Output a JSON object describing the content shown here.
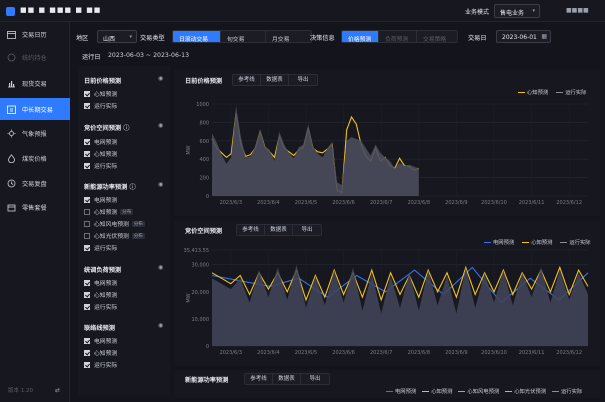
{
  "header": {
    "app_name": "■■ ■ ■■■ ■ ■■",
    "mode_label": "业务模式",
    "mode_value": "售电业务",
    "user": "■■■■"
  },
  "sidebar": {
    "items": [
      {
        "label": "交易日历",
        "icon": "calendar-icon"
      },
      {
        "label": "统约持仓",
        "icon": "position-icon",
        "disabled": true
      },
      {
        "label": "现货交易",
        "icon": "bar-chart-icon"
      },
      {
        "label": "中长期交易",
        "icon": "schedule-icon",
        "active": true
      },
      {
        "label": "气象预报",
        "icon": "sun-icon"
      },
      {
        "label": "煤炭价格",
        "icon": "flame-icon"
      },
      {
        "label": "交易复盘",
        "icon": "history-icon"
      },
      {
        "label": "零售套餐",
        "icon": "package-icon"
      }
    ],
    "version": "版本 1.20"
  },
  "filter": {
    "region_label": "地区",
    "region_value": "山西",
    "trade_type_label": "交易类型",
    "trade_types": [
      "日滚动交易",
      "旬交易",
      "月交易"
    ],
    "decision_label": "决策信息",
    "decisions": [
      "价格预测",
      "负荷预测",
      "交易策略"
    ],
    "trade_date_label": "交易日",
    "trade_date_value": "2023-06-01",
    "run_label": "运行日",
    "run_range": "2023-06-03 ~ 2023-06-13"
  },
  "left_panel": {
    "groups": [
      {
        "title": "日前价格预测",
        "items": [
          {
            "label": "心知预测",
            "checked": true
          },
          {
            "label": "运行实际",
            "checked": true
          }
        ]
      },
      {
        "title": "竞价空间预测",
        "info": true,
        "items": [
          {
            "label": "电网预测",
            "checked": true
          },
          {
            "label": "心知预测",
            "checked": true
          },
          {
            "label": "运行实际",
            "checked": true
          }
        ]
      },
      {
        "title": "新能源功率预测",
        "info": true,
        "items": [
          {
            "label": "电网预测",
            "checked": true
          },
          {
            "label": "心知预测",
            "checked": false,
            "tag": "分布"
          },
          {
            "label": "心知风电预测",
            "checked": false,
            "tag": "分布"
          },
          {
            "label": "心知光伏预测",
            "checked": false,
            "tag": "分布"
          },
          {
            "label": "运行实际",
            "checked": true
          }
        ]
      },
      {
        "title": "统调负荷预测",
        "items": [
          {
            "label": "电网预测",
            "checked": true
          },
          {
            "label": "心知预测",
            "checked": true
          },
          {
            "label": "运行实际",
            "checked": true
          }
        ]
      },
      {
        "title": "联络线预测",
        "items": [
          {
            "label": "电网预测",
            "checked": true
          },
          {
            "label": "心知预测",
            "checked": true
          },
          {
            "label": "运行实际",
            "checked": true
          }
        ]
      }
    ]
  },
  "chart_tabs": [
    "参考线",
    "数据表",
    "导出"
  ],
  "charts": {
    "price": {
      "title": "日前价格预测",
      "legend": [
        "心知预测",
        "运行实际"
      ]
    },
    "bid": {
      "title": "竞价空间预测",
      "legend": [
        "电网预测",
        "心知预测",
        "运行实际"
      ]
    },
    "renew": {
      "title": "新能源功率预测",
      "legend": [
        "电网预测",
        "心知预测",
        "心知风电预测",
        "心知光伏预测",
        "运行实际"
      ]
    }
  },
  "colors": {
    "accent": "#2f7bff",
    "forecast": "#f2c21b",
    "grid_forecast": "#3a6ff0",
    "actual_fill": "#5b5d6e"
  },
  "chart_data": [
    {
      "type": "area",
      "title": "日前价格预测",
      "ylabel": "MW",
      "ylim": [
        0,
        1000
      ],
      "yticks": [
        "0",
        "200",
        "400",
        "600",
        "800",
        "1000"
      ],
      "x": [
        "2023/6/3",
        "2023/6/4",
        "2023/6/5",
        "2023/6/6",
        "2023/6/7",
        "2023/6/8",
        "2023/6/9",
        "2023/6/10",
        "2023/6/11",
        "2023/6/12"
      ],
      "series": [
        {
          "name": "心知预测",
          "values": [
            620,
            520,
            470,
            420,
            460,
            900,
            560,
            430,
            450,
            520,
            700,
            530,
            480,
            420,
            650,
            520,
            480,
            440,
            500,
            530,
            740,
            520,
            480,
            470,
            510,
            560,
            60,
            40,
            720,
            860,
            780,
            560,
            430,
            380,
            520,
            380,
            420,
            330,
            300,
            410,
            330,
            320,
            280,
            300
          ]
        },
        {
          "name": "运行实际",
          "values": [
            680,
            580,
            450,
            350,
            420,
            980,
            640,
            420,
            430,
            540,
            720,
            540,
            500,
            380,
            700,
            560,
            470,
            410,
            530,
            560,
            780,
            540,
            460,
            420,
            520,
            590,
            150,
            120,
            600,
            640,
            620,
            600,
            520,
            440,
            560,
            470,
            420,
            380,
            300,
            360,
            330,
            340,
            320,
            300
          ]
        }
      ]
    },
    {
      "type": "line",
      "title": "竞价空间预测",
      "ylabel": "MW",
      "ylim": [
        0,
        35413.5
      ],
      "yticks": [
        "0",
        "10,000",
        "20,000",
        "30,000",
        "35,413.55"
      ],
      "x": [
        "2023/6/3",
        "2023/6/4",
        "2023/6/5",
        "2023/6/6",
        "2023/6/7",
        "2023/6/8",
        "2023/6/9",
        "2023/6/10",
        "2023/6/11",
        "2023/6/12"
      ],
      "series": [
        {
          "name": "电网预测",
          "values": [
            26000,
            24000,
            22000,
            25000,
            18000,
            26000,
            20000,
            28000,
            19000,
            29000,
            16000,
            25000,
            17000,
            27000
          ]
        },
        {
          "name": "心知预测",
          "values": [
            27000,
            25000,
            23000,
            26000,
            19000,
            27000,
            21000,
            27000,
            20000,
            28000,
            17000,
            26000,
            18000,
            28000,
            19000,
            27000,
            18000,
            28000,
            17000,
            27000,
            19000,
            26000,
            18000,
            28000,
            20000,
            27000,
            18000,
            29000,
            19000,
            27000,
            20000,
            28000,
            19000,
            27000,
            21000,
            28000,
            20000,
            29000,
            19000,
            28000,
            22000
          ]
        },
        {
          "name": "运行实际",
          "values": [
            25000,
            23000,
            21000,
            25000,
            16000,
            28000,
            18000,
            29000,
            17000,
            30000,
            14000,
            26000,
            15000,
            28000,
            16000,
            29000,
            13000,
            27000,
            12000,
            26000,
            14000,
            27000,
            13000,
            28000,
            15000,
            26000,
            12000,
            29000,
            14000,
            27000,
            16000,
            28000,
            15000,
            27000,
            18000,
            29000,
            16000,
            28000,
            17000,
            27000,
            19000
          ]
        }
      ]
    }
  ]
}
